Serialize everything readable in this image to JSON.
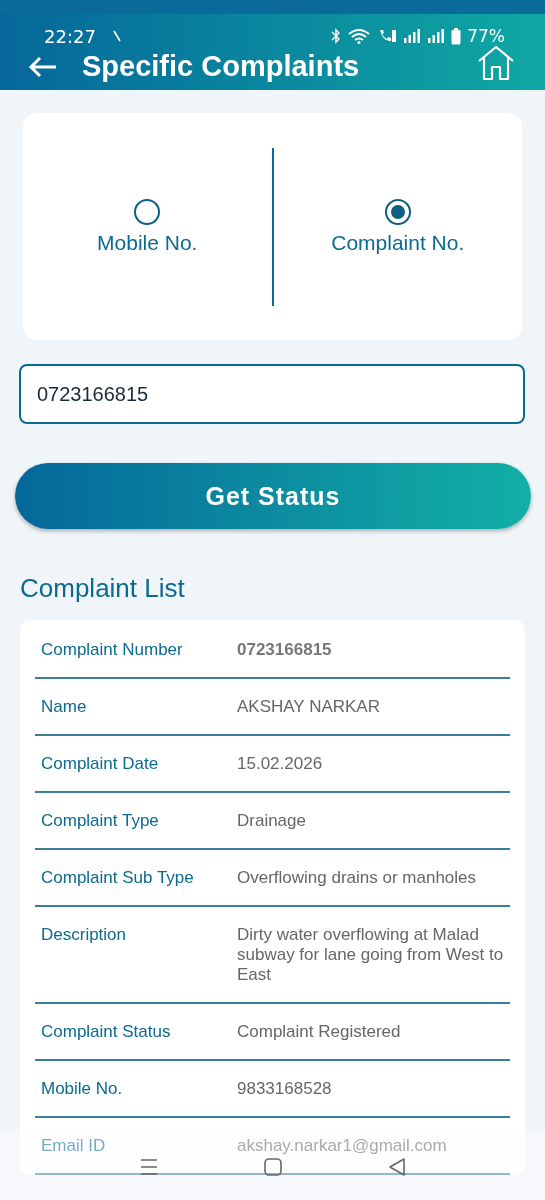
{
  "status_bar": {
    "time": "22:27",
    "battery": "77%"
  },
  "header": {
    "title": "Specific Complaints"
  },
  "search_by": [
    {
      "label": "Mobile No.",
      "selected": false
    },
    {
      "label": "Complaint No.",
      "selected": true
    }
  ],
  "input": {
    "value": "0723166815"
  },
  "button": "Get Status",
  "section_title": "Complaint List",
  "rows": [
    {
      "label": "Complaint Number",
      "value": "0723166815",
      "bold": true
    },
    {
      "label": "Name",
      "value": "AKSHAY  NARKAR",
      "bold": false
    },
    {
      "label": "Complaint Date",
      "value": "15.02.2026",
      "bold": false
    },
    {
      "label": "Complaint Type",
      "value": "Drainage",
      "bold": false
    },
    {
      "label": "Complaint Sub Type",
      "value": "Overflowing drains or manholes",
      "bold": false
    },
    {
      "label": "Description",
      "value": "Dirty water overflowing at Malad subway for lane going from West to East",
      "bold": false
    },
    {
      "label": "Complaint Status",
      "value": "Complaint Registered",
      "bold": false
    },
    {
      "label": "Mobile No.",
      "value": "9833168528",
      "bold": false
    },
    {
      "label": "Email ID",
      "value": "akshay.narkar1@gmail.com",
      "bold": false
    }
  ]
}
